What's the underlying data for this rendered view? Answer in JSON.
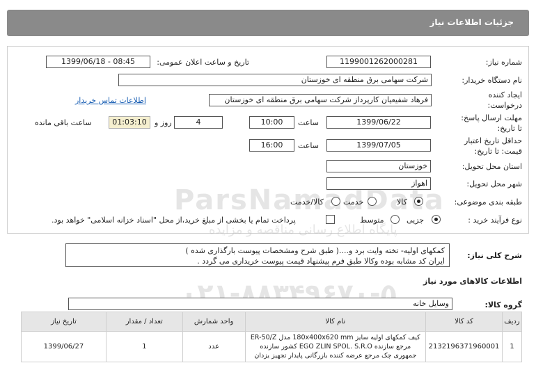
{
  "header": {
    "title": "جزئیات اطلاعات نیاز"
  },
  "fields": {
    "need_number_label": "شماره نیاز:",
    "need_number": "1199001262000281",
    "announce_label": "تاریخ و ساعت اعلان عمومی:",
    "announce_value": "1399/06/18 - 08:45",
    "buyer_label": "نام دستگاه خریدار:",
    "buyer_value": "شرکت سهامی برق منطقه ای خوزستان",
    "creator_label": "ایجاد کننده درخواست:",
    "creator_value": "فرهاد شفیعیان کارپرداز شرکت سهامی برق منطقه ای خوزستان",
    "contact_link": "اطلاعات تماس خریدار",
    "deadline_label": "مهلت ارسال پاسخ: تا تاریخ:",
    "deadline_date": "1399/06/22",
    "time_label": "ساعت",
    "deadline_time": "10:00",
    "days_value": "4",
    "days_label": "روز و",
    "timer_value": "01:03:10",
    "remaining_label": "ساعت باقی مانده",
    "validity_label": "حداقل تاریخ اعتبار قیمت: تا تاریخ:",
    "validity_date": "1399/07/05",
    "validity_time": "16:00",
    "province_label": "استان محل تحویل:",
    "province_value": "خوزستان",
    "city_label": "شهر محل تحویل:",
    "city_value": "اهواز",
    "category_label": "طبقه بندی موضوعی:",
    "category_options": [
      "کالا",
      "خدمت",
      "کالا/خدمت"
    ],
    "process_label": "نوع فرآیند خرید :",
    "process_options": [
      "جزیی",
      "متوسط"
    ],
    "payment_note": "پرداخت تمام یا بخشی از مبلغ خرید،از محل \"اسناد خزانه اسلامی\" خواهد بود."
  },
  "description": {
    "label": "شرح کلی نیاز:",
    "line1": "کمکهای اولیه- تخته وایت برد و....( طبق شرح ومشخصات پیوست بارگذاری شده  )",
    "line2": "ایران کد مشابه بوده وکالا طبق فرم پیشنهاد قیمت پیوست خریداری می گردد ."
  },
  "goods_section": {
    "title": "اطلاعات کالاهای مورد نیاز",
    "group_label": "گروه کالا:",
    "group_value": "وسایل خانه"
  },
  "table": {
    "headers": [
      "ردیف",
      "کد کالا",
      "نام کالا",
      "واحد شمارش",
      "تعداد / مقدار",
      "تاریخ نیاز"
    ],
    "rows": [
      {
        "index": "1",
        "code": "2132196371960001",
        "name_line1": "کیف کمکهای اولیه سایز 180x400x620 mm مدل ER-50/Z",
        "name_line2": "مرجع سازنده EGO ZLIN SPOL. S.R.O کشور سازنده",
        "name_line3": "جمهوری چک مرجع عرضه کننده بازرگانی پایدار تجهیز یزدان",
        "unit": "عدد",
        "qty": "1",
        "date": "1399/06/27"
      }
    ]
  },
  "watermark": {
    "brand": "ParsNamadData",
    "subtitle": "پایگاه اطلاع رسانی مناقصه و مزایده",
    "phone": "۰۲۱-۸۸۳۴۹۶۷۰-۵"
  }
}
